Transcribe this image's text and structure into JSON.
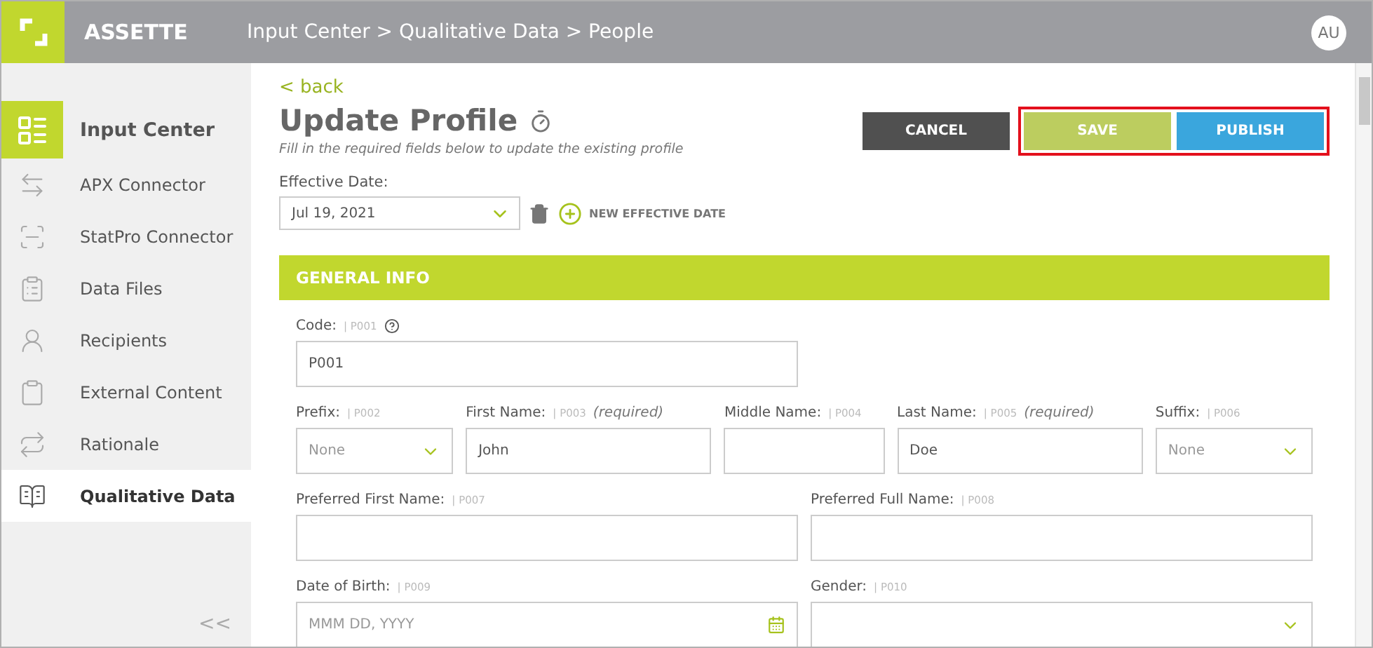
{
  "header": {
    "brand": "ASSETTE",
    "breadcrumb": "Input Center > Qualitative Data > People",
    "avatar": "AU"
  },
  "sidebar": {
    "section": "Input Center",
    "items": [
      {
        "label": "APX Connector",
        "selected": false
      },
      {
        "label": "StatPro Connector",
        "selected": false
      },
      {
        "label": "Data Files",
        "selected": false
      },
      {
        "label": "Recipients",
        "selected": false
      },
      {
        "label": "External Content",
        "selected": false
      },
      {
        "label": "Rationale",
        "selected": false
      },
      {
        "label": "Qualitative Data",
        "selected": true
      }
    ],
    "collapse": "<<"
  },
  "page": {
    "back": "< back",
    "title": "Update Profile",
    "subtitle": "Fill in the required fields below to update the existing profile",
    "buttons": [
      {
        "label": "CANCEL",
        "kind": "cancel"
      },
      {
        "label": "SAVE",
        "kind": "save",
        "highlighted": true
      },
      {
        "label": "PUBLISH",
        "kind": "publish",
        "highlighted": true
      }
    ],
    "effective_date": {
      "label": "Effective Date:",
      "value": "Jul 19, 2021",
      "new_label": "NEW EFFECTIVE DATE"
    },
    "section": "GENERAL INFO",
    "rows": [
      [
        {
          "label": "Code:",
          "code": "| P001",
          "kind": "text",
          "value": "P001",
          "help": true
        }
      ],
      [
        {
          "label": "Prefix:",
          "code": "| P002",
          "kind": "select",
          "placeholder": "None"
        },
        {
          "label": "First Name:",
          "code": "| P003",
          "note": "(required)",
          "kind": "text",
          "value": "John"
        },
        {
          "label": "Middle Name:",
          "code": "| P004",
          "kind": "text"
        },
        {
          "label": "Last Name:",
          "code": "| P005",
          "note": "(required)",
          "kind": "text",
          "value": "Doe"
        },
        {
          "label": "Suffix:",
          "code": "| P006",
          "kind": "select",
          "placeholder": "None"
        }
      ],
      [
        {
          "label": "Preferred First Name:",
          "code": "| P007",
          "kind": "text"
        },
        {
          "label": "Preferred Full Name:",
          "code": "| P008",
          "kind": "text"
        }
      ],
      [
        {
          "label": "Date of Birth:",
          "code": "| P009",
          "kind": "date",
          "placeholder": "MMM DD, YYYY"
        },
        {
          "label": "Gender:",
          "code": "| P010",
          "kind": "select"
        }
      ]
    ]
  }
}
